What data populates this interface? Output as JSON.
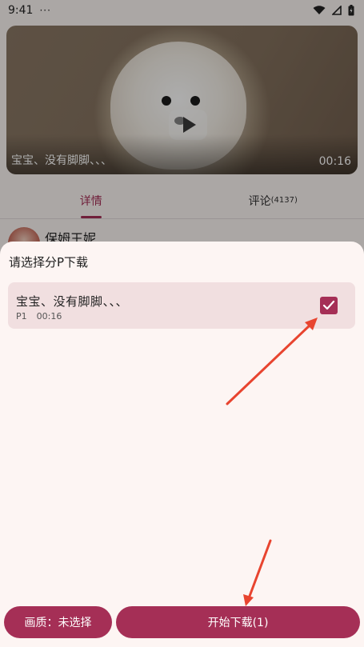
{
  "status_bar": {
    "time": "9:41",
    "more": "···"
  },
  "video": {
    "caption": "宝宝、没有脚脚、、、",
    "duration": "00:16"
  },
  "tabs": [
    {
      "label": "详情",
      "count": ""
    },
    {
      "label": "评论",
      "count": "(4137)"
    }
  ],
  "author": {
    "name": "保姆王妮"
  },
  "sheet": {
    "title": "请选择分P下载",
    "episodes": [
      {
        "title": "宝宝、没有脚脚、、、",
        "part": "P1",
        "duration": "00:16",
        "selected": true
      }
    ],
    "quality_button": "画质：未选择",
    "download_button": "开始下载(1)"
  },
  "colors": {
    "accent": "#a52f56",
    "sheet_bg": "#fdf5f3",
    "episode_bg": "#f1dfe0",
    "arrow": "#e8442f"
  }
}
